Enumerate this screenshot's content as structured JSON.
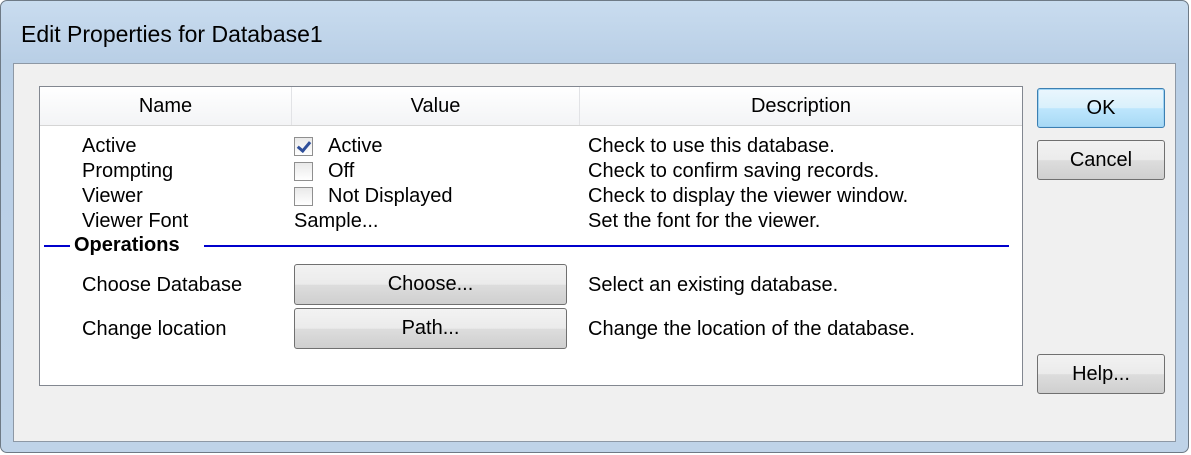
{
  "window": {
    "title": "Edit Properties for Database1"
  },
  "grid": {
    "columns": [
      "Name",
      "Value",
      "Description"
    ],
    "rows": [
      {
        "name": "Active",
        "checked": true,
        "value": "Active",
        "description": "Check to use this database."
      },
      {
        "name": "Prompting",
        "checked": false,
        "value": "Off",
        "description": "Check to confirm saving records."
      },
      {
        "name": "Viewer",
        "checked": false,
        "value": "Not Displayed",
        "description": "Check to display the viewer window."
      },
      {
        "name": "Viewer Font",
        "value": "Sample...",
        "description": "Set the font for the viewer."
      }
    ],
    "section": "Operations",
    "operations": [
      {
        "name": "Choose Database",
        "button": "Choose...",
        "description": "Select an existing database."
      },
      {
        "name": "Change location",
        "button": "Path...",
        "description": "Change the location of the database."
      }
    ]
  },
  "buttons": {
    "ok": "OK",
    "cancel": "Cancel",
    "help": "Help..."
  },
  "colors": {
    "separator": "#0000cc",
    "default_button_border": "#3c7fb1"
  }
}
